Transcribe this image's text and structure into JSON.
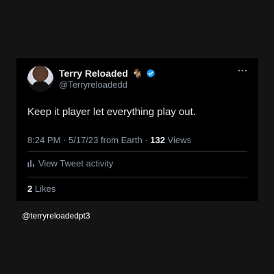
{
  "tweet": {
    "display_name": "Terry Reloaded",
    "name_emoji": "🐐",
    "handle": "@Terryreloadedd",
    "text": "Keep it player let everything play out.",
    "time": "8:24 PM",
    "date": "5/17/23",
    "source": "from Earth",
    "views_count": "132",
    "views_label": "Views",
    "activity_label": "View Tweet activity",
    "likes_count": "2",
    "likes_label": "Likes"
  },
  "watermark": "@terryreloadedpt3",
  "colors": {
    "page_bg": "#141414",
    "card_bg": "#000000",
    "primary_text": "#e7e9ea",
    "secondary_text": "#8b98a5",
    "verified_blue": "#1d9bf0",
    "divider": "#2f3336"
  },
  "icons": {
    "verified": "verified-badge-icon",
    "more": "more-options-icon",
    "activity": "bar-chart-icon"
  }
}
